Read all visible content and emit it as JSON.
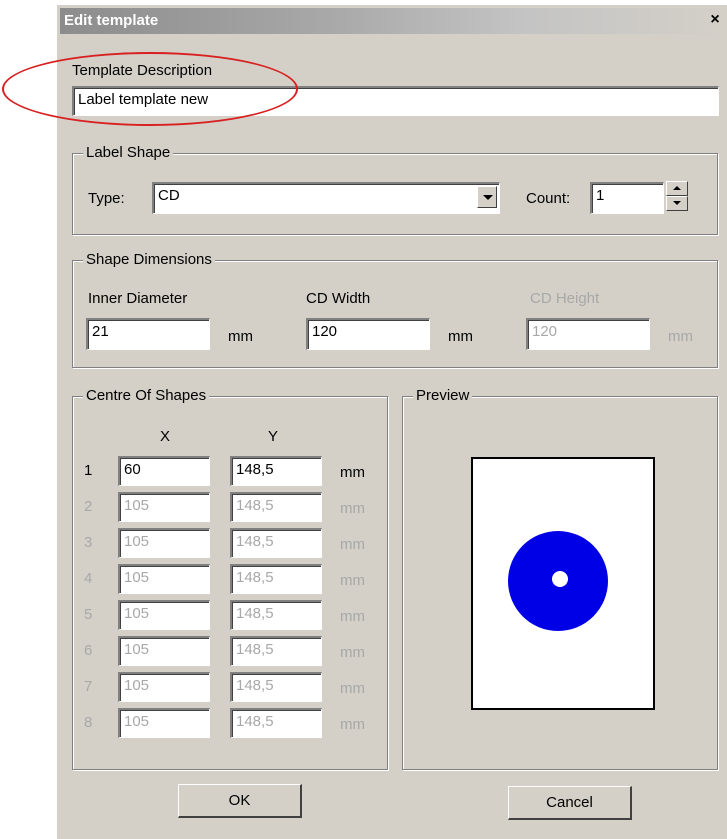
{
  "window": {
    "title": "Edit template",
    "close_label": "×"
  },
  "template_description": {
    "label": "Template Description",
    "value": "Label template new"
  },
  "label_shape": {
    "legend": "Label Shape",
    "type_label": "Type:",
    "type_value": "CD",
    "count_label": "Count:",
    "count_value": "1"
  },
  "shape_dimensions": {
    "legend": "Shape Dimensions",
    "inner_diameter_label": "Inner Diameter",
    "inner_diameter_value": "21",
    "cd_width_label": "CD Width",
    "cd_width_value": "120",
    "cd_height_label": "CD Height",
    "cd_height_value": "120",
    "unit": "mm"
  },
  "centre_of_shapes": {
    "legend": "Centre Of Shapes",
    "x_header": "X",
    "y_header": "Y",
    "unit": "mm",
    "rows": [
      {
        "index": "1",
        "x": "60",
        "y": "148,5",
        "enabled": true
      },
      {
        "index": "2",
        "x": "105",
        "y": "148,5",
        "enabled": false
      },
      {
        "index": "3",
        "x": "105",
        "y": "148,5",
        "enabled": false
      },
      {
        "index": "4",
        "x": "105",
        "y": "148,5",
        "enabled": false
      },
      {
        "index": "5",
        "x": "105",
        "y": "148,5",
        "enabled": false
      },
      {
        "index": "6",
        "x": "105",
        "y": "148,5",
        "enabled": false
      },
      {
        "index": "7",
        "x": "105",
        "y": "148,5",
        "enabled": false
      },
      {
        "index": "8",
        "x": "105",
        "y": "148,5",
        "enabled": false
      }
    ]
  },
  "preview": {
    "legend": "Preview",
    "cd_color": "#0000e6"
  },
  "buttons": {
    "ok": "OK",
    "cancel": "Cancel"
  },
  "colors": {
    "annotation": "#d82020",
    "dialog_bg": "#d4d0c8"
  }
}
